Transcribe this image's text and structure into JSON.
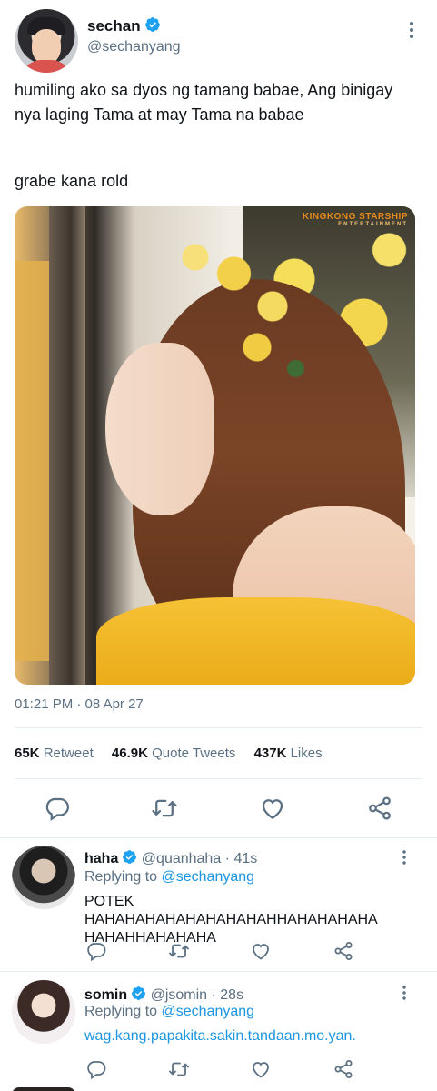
{
  "tweet": {
    "author": {
      "name": "sechan",
      "handle": "@sechanyang",
      "verified": true,
      "avatar_icon": "profile-photo"
    },
    "text_line1": "humiling ako sa dyos ng tamang babae, Ang binigay nya laging Tama at may Tama na babae",
    "text_line2": "grabe kana rold",
    "image": {
      "description_icon": "photo",
      "watermark": "KINGKONG STARSHIP",
      "watermark_sub": "ENTERTAINMENT"
    },
    "timestamp": "01:21 PM · 08 Apr 27",
    "stats": {
      "retweets": "65K",
      "retweets_label": "Retweet",
      "quotes": "46.9K",
      "quotes_label": "Quote Tweets",
      "likes": "437K",
      "likes_label": "Likes"
    },
    "actions": [
      "reply-icon",
      "retweet-icon",
      "like-icon",
      "share-icon"
    ]
  },
  "replies": [
    {
      "name": "haha",
      "handle": "@quanhaha",
      "time": "41s",
      "replying_label": "Replying to",
      "replying_to": "@sechanyang",
      "text": "POTEK HAHAHAHAHAHAHAHAHAHHAHAHAHAHA HAHAHHAHAHAHA"
    },
    {
      "name": "somin",
      "handle": "@jsomin",
      "time": "28s",
      "replying_label": "Replying to",
      "replying_to": "@sechanyang",
      "text": "wag.kang.papakita.sakin.tandaan.mo.yan."
    }
  ],
  "colors": {
    "accent": "#1da1f2",
    "link": "#1b95e0",
    "secondary_text": "#5b7083",
    "divider": "#e6ecf0"
  }
}
